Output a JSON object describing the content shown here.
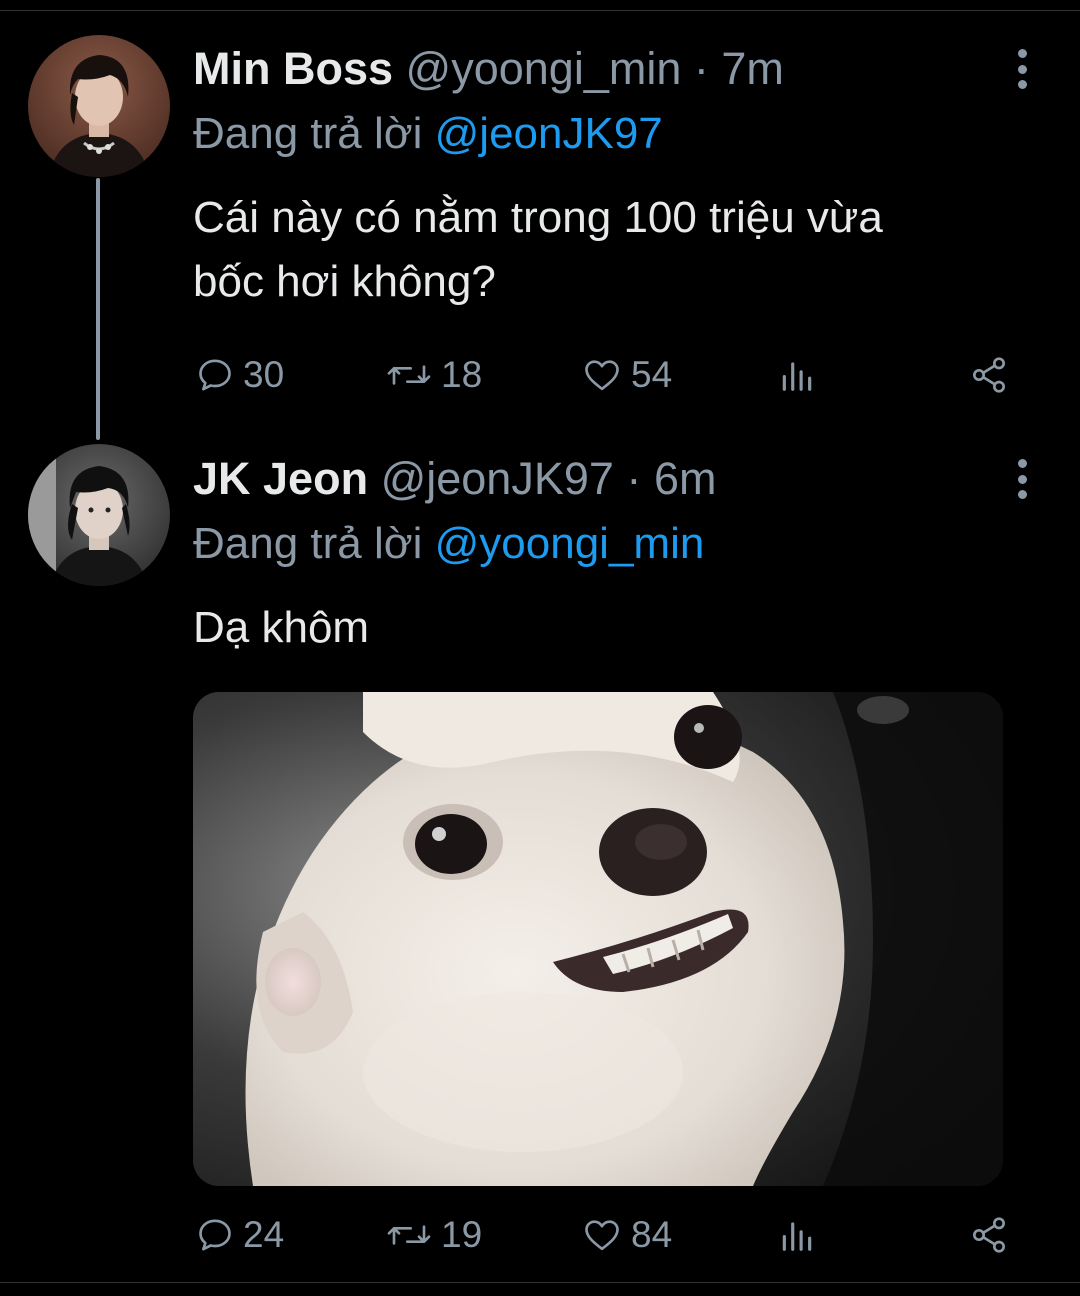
{
  "tweets": [
    {
      "name": "Min Boss",
      "handle": "@yoongi_min",
      "separator": "·",
      "time": "7m",
      "reply_prefix": "Đang trả lời",
      "reply_to": "@jeonJK97",
      "text_line1": "Cái này có nằm trong 100 triệu vừa",
      "text_line2": "bốc hơi không?",
      "replies": "30",
      "retweets": "18",
      "likes": "54"
    },
    {
      "name": "JK Jeon",
      "handle": "@jeonJK97",
      "separator": "·",
      "time": "6m",
      "reply_prefix": "Đang trả lời",
      "reply_to": "@yoongi_min",
      "text_line1": "Dạ khôm",
      "replies": "24",
      "retweets": "19",
      "likes": "84",
      "media": "white chihuahua meme photo"
    }
  ],
  "icons": {
    "reply": "reply-icon",
    "retweet": "retweet-icon",
    "like": "heart-icon",
    "analytics": "analytics-icon",
    "share": "share-icon",
    "more": "more-vertical-icon"
  },
  "colors": {
    "background": "#000000",
    "text": "#e7e9ea",
    "secondary": "#8b98a5",
    "mention": "#1d9bf0"
  }
}
